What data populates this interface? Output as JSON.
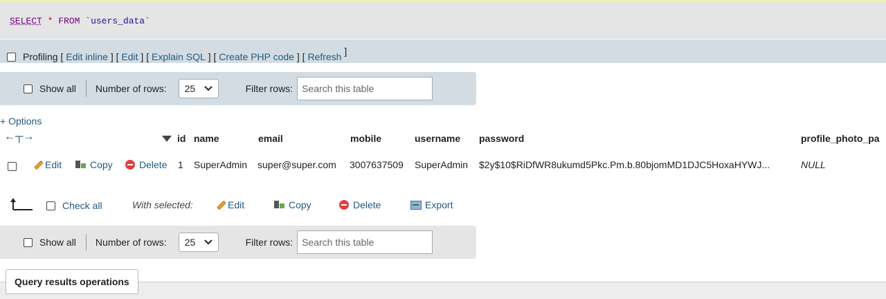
{
  "sql": {
    "keyword": "SELECT",
    "star": "*",
    "from": "FROM",
    "table": "`users_data`"
  },
  "profiling": {
    "label": "Profiling",
    "edit_inline": "Edit inline",
    "edit": "Edit",
    "explain": "Explain SQL",
    "create_php": "Create PHP code",
    "refresh": "Refresh"
  },
  "nav": {
    "show_all": "Show all",
    "rows_label": "Number of rows:",
    "rows_value": "25",
    "filter_label": "Filter rows:",
    "search_placeholder": "Search this table"
  },
  "options_label": "+ Options",
  "table": {
    "columns": [
      "id",
      "name",
      "email",
      "mobile",
      "username",
      "password",
      "profile_photo_pa"
    ],
    "row": {
      "edit": "Edit",
      "copy": "Copy",
      "delete": "Delete",
      "id": "1",
      "name": "SuperAdmin",
      "email": "super@super.com",
      "mobile": "3007637509",
      "username": "SuperAdmin",
      "password": "$2y$10$RiDfWR8ukumd5Pkc.Pm.b.80bjomMD1DJC5HoxaHYWJ...",
      "profile_photo": "NULL"
    }
  },
  "bulk": {
    "check_all": "Check all",
    "with_selected": "With selected:",
    "edit": "Edit",
    "copy": "Copy",
    "delete": "Delete",
    "export": "Export"
  },
  "footer": {
    "query_results_operations": "Query results operations"
  }
}
